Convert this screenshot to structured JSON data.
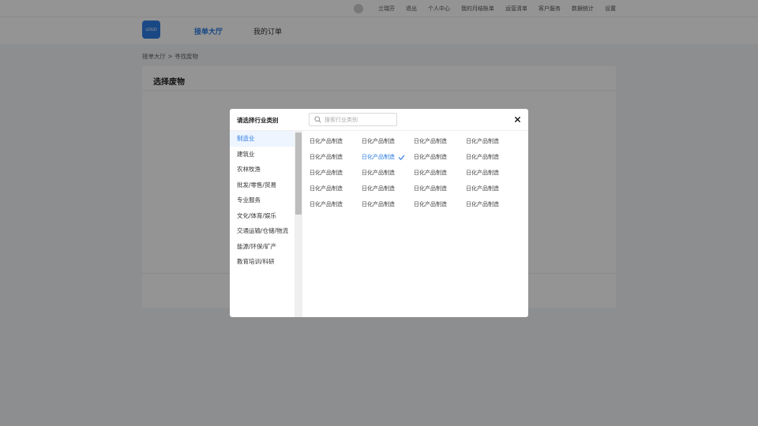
{
  "topbar": {
    "user_name": "兰瑞芬",
    "links": [
      "退出",
      "个人中心",
      "我的月结账单",
      "运营清单",
      "客户服务",
      "数据统计",
      "设置"
    ]
  },
  "header": {
    "logo_text": "LOGO",
    "nav": [
      "接单大厅",
      "我的订单"
    ],
    "active_nav": "接单大厅"
  },
  "breadcrumb": "接单大厅 > 寻找废物",
  "card": {
    "title": "选择废物"
  },
  "modal": {
    "title": "请选择行业类别",
    "search_placeholder": "搜索行业类别",
    "categories": [
      "制造业",
      "建筑业",
      "农林牧渔",
      "批发/零售/贸易",
      "专业服务",
      "文化/体育/娱乐",
      "交通运输/仓储/物流",
      "能源/环保/矿产",
      "教育培训/科研"
    ],
    "active_category": "制造业",
    "subcategories": [
      "日化产品制造",
      "日化产品制造",
      "日化产品制造",
      "日化产品制造",
      "日化产品制造",
      "日化产品制造",
      "日化产品制造",
      "日化产品制造",
      "日化产品制造",
      "日化产品制造",
      "日化产品制造",
      "日化产品制造",
      "日化产品制造",
      "日化产品制造",
      "日化产品制造",
      "日化产品制造",
      "日化产品制造",
      "日化产品制造",
      "日化产品制造",
      "日化产品制造"
    ],
    "selected_subcategory_index": 5
  },
  "colors": {
    "accent": "#2d7ce3",
    "overlay": "rgba(0,0,0,0.42)"
  },
  "icons": {
    "search": "search-icon",
    "close": "close-icon",
    "selected": "checkmark-icon"
  }
}
